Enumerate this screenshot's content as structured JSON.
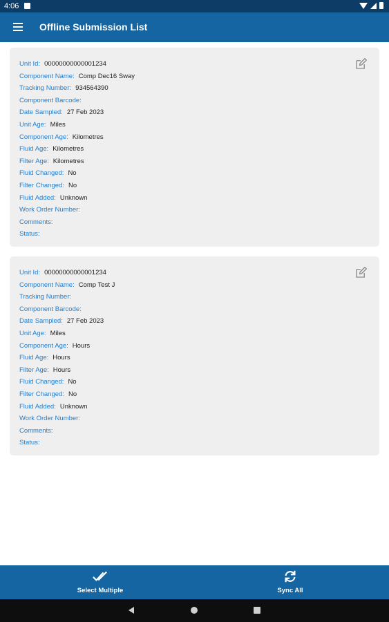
{
  "status_bar": {
    "time": "4:06"
  },
  "app_bar": {
    "title": "Offline Submission List"
  },
  "labels": {
    "unit_id": "Unit Id:",
    "component_name": "Component Name:",
    "tracking_number": "Tracking Number:",
    "component_barcode": "Component Barcode:",
    "date_sampled": "Date Sampled:",
    "unit_age": "Unit Age:",
    "component_age": "Component Age:",
    "fluid_age": "Fluid Age:",
    "filter_age": "Filter Age:",
    "fluid_changed": "Fluid Changed:",
    "filter_changed": "Filter Changed:",
    "fluid_added": "Fluid Added:",
    "work_order_number": "Work Order Number:",
    "comments": "Comments:",
    "status": "Status:"
  },
  "submissions": [
    {
      "unit_id": "00000000000001234",
      "component_name": "Comp Dec16 Sway",
      "tracking_number": "934564390",
      "component_barcode": "",
      "date_sampled": "27 Feb 2023",
      "unit_age": "Miles",
      "component_age": "Kilometres",
      "fluid_age": "Kilometres",
      "filter_age": "Kilometres",
      "fluid_changed": "No",
      "filter_changed": "No",
      "fluid_added": "Unknown",
      "work_order_number": "",
      "comments": "",
      "status": ""
    },
    {
      "unit_id": "00000000000001234",
      "component_name": "Comp Test J",
      "tracking_number": "",
      "component_barcode": "",
      "date_sampled": "27 Feb 2023",
      "unit_age": "Miles",
      "component_age": "Hours",
      "fluid_age": "Hours",
      "filter_age": "Hours",
      "fluid_changed": "No",
      "filter_changed": "No",
      "fluid_added": "Unknown",
      "work_order_number": "",
      "comments": "",
      "status": ""
    }
  ],
  "bottom_bar": {
    "select_multiple_label": "Select Multiple",
    "sync_all_label": "Sync All"
  },
  "icons": {
    "menu": "hamburger-menu-icon",
    "edit": "edit-pencil-square-icon",
    "select_multiple": "double-check-icon",
    "sync": "sync-refresh-icon",
    "nav_back": "triangle-back-icon",
    "nav_home": "circle-home-icon",
    "nav_recent": "square-recents-icon"
  },
  "colors": {
    "app_bar": "#1565a3",
    "status_bar": "#0d3d66",
    "label_blue": "#1f7ed0",
    "card_bg": "#efefef"
  }
}
